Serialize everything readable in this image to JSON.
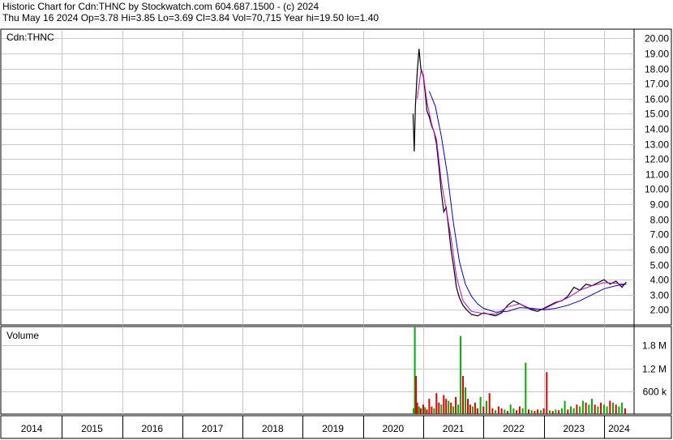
{
  "header": {
    "line1": "Historic Chart for Cdn:THNC by Stockwatch.com 604.687.1500 - (c) 2024",
    "line2": "Thu May 16 2024  Op=3.78  Hi=3.85  Lo=3.69  Cl=3.84  Vol=70,715  Year hi=19.50  lo=1.40"
  },
  "colors": {
    "price": "#000000",
    "ma_short": "#cc00cc",
    "ma_long": "#0000cc",
    "volume_up": "#00b000",
    "volume_down": "#e00000",
    "grid": "#c8c8c8"
  },
  "chart_data": [
    {
      "type": "line",
      "panel": "price",
      "label": "Cdn:THNC",
      "ylim": [
        1,
        20.5
      ],
      "y_ticks": [
        "20.00",
        "19.00",
        "18.00",
        "17.00",
        "16.00",
        "15.00",
        "14.00",
        "13.00",
        "12.00",
        "11.00",
        "10.00",
        "9.00",
        "8.00",
        "7.00",
        "6.00",
        "5.00",
        "4.00",
        "3.00",
        "2.00"
      ],
      "x_ticks": [
        "2014",
        "2015",
        "2016",
        "2017",
        "2018",
        "2019",
        "2020",
        "2021",
        "2022",
        "2023",
        "2024"
      ],
      "xlim": [
        2014,
        2024.5
      ],
      "grid": true,
      "series": [
        {
          "role": "price",
          "x": [
            2020.83,
            2020.85,
            2020.87,
            2020.9,
            2020.93,
            2020.96,
            2021.0,
            2021.03,
            2021.06,
            2021.1,
            2021.14,
            2021.18,
            2021.22,
            2021.26,
            2021.3,
            2021.34,
            2021.38,
            2021.42,
            2021.46,
            2021.5,
            2021.55,
            2021.6,
            2021.66,
            2021.72,
            2021.8,
            2021.9,
            2022.0,
            2022.1,
            2022.2,
            2022.3,
            2022.4,
            2022.5,
            2022.6,
            2022.7,
            2022.8,
            2022.9,
            2023.0,
            2023.1,
            2023.2,
            2023.3,
            2023.4,
            2023.5,
            2023.6,
            2023.7,
            2023.8,
            2023.9,
            2024.0,
            2024.1,
            2024.2,
            2024.3,
            2024.37
          ],
          "y": [
            15.0,
            12.5,
            15.5,
            17.8,
            19.3,
            18.0,
            17.5,
            16.5,
            15.2,
            14.8,
            14.2,
            13.8,
            13.0,
            11.5,
            9.8,
            8.5,
            8.8,
            7.5,
            6.0,
            5.0,
            3.5,
            2.8,
            2.3,
            2.0,
            1.7,
            1.6,
            1.8,
            1.7,
            1.6,
            1.8,
            2.3,
            2.6,
            2.4,
            2.2,
            2.0,
            1.9,
            2.1,
            2.3,
            2.5,
            2.6,
            2.9,
            3.5,
            3.3,
            3.7,
            3.6,
            3.8,
            4.0,
            3.7,
            3.9,
            3.5,
            3.84
          ]
        },
        {
          "role": "moving-average-short",
          "x": [
            2020.9,
            2020.96,
            2021.0,
            2021.06,
            2021.14,
            2021.22,
            2021.3,
            2021.38,
            2021.46,
            2021.55,
            2021.66,
            2021.8,
            2022.0,
            2022.2,
            2022.4,
            2022.6,
            2022.8,
            2023.0,
            2023.2,
            2023.4,
            2023.6,
            2023.8,
            2024.0,
            2024.2,
            2024.37
          ],
          "y": [
            16.0,
            17.8,
            17.6,
            15.8,
            14.3,
            13.3,
            10.5,
            8.7,
            6.8,
            4.2,
            2.6,
            1.9,
            1.75,
            1.7,
            2.2,
            2.4,
            2.05,
            2.05,
            2.45,
            2.8,
            3.3,
            3.6,
            3.8,
            3.75,
            3.7
          ]
        },
        {
          "role": "moving-average-long",
          "x": [
            2021.1,
            2021.2,
            2021.3,
            2021.4,
            2021.5,
            2021.6,
            2021.7,
            2021.8,
            2021.9,
            2022.0,
            2022.2,
            2022.4,
            2022.6,
            2022.8,
            2023.0,
            2023.2,
            2023.4,
            2023.6,
            2023.8,
            2024.0,
            2024.2,
            2024.37
          ],
          "y": [
            16.5,
            15.5,
            13.5,
            11.0,
            7.8,
            5.2,
            3.7,
            2.9,
            2.4,
            2.1,
            1.85,
            1.9,
            2.15,
            2.1,
            2.0,
            2.1,
            2.3,
            2.6,
            3.0,
            3.4,
            3.6,
            3.7
          ]
        }
      ]
    },
    {
      "type": "bar",
      "panel": "volume",
      "label": "Volume",
      "ylim": [
        0,
        2300000
      ],
      "y_ticks": [
        {
          "value": 1800000,
          "label": "1.8 M"
        },
        {
          "value": 1200000,
          "label": "1.2 M"
        },
        {
          "value": 600000,
          "label": "600 k"
        }
      ],
      "grid": true,
      "x": [
        2020.84,
        2020.86,
        2020.88,
        2020.9,
        2020.93,
        2020.96,
        2021.0,
        2021.03,
        2021.06,
        2021.1,
        2021.14,
        2021.18,
        2021.22,
        2021.26,
        2021.3,
        2021.34,
        2021.38,
        2021.42,
        2021.46,
        2021.5,
        2021.54,
        2021.58,
        2021.62,
        2021.66,
        2021.7,
        2021.74,
        2021.78,
        2021.82,
        2021.86,
        2021.9,
        2021.95,
        2022.0,
        2022.05,
        2022.1,
        2022.15,
        2022.2,
        2022.25,
        2022.3,
        2022.35,
        2022.4,
        2022.45,
        2022.5,
        2022.55,
        2022.6,
        2022.65,
        2022.7,
        2022.75,
        2022.8,
        2022.85,
        2022.9,
        2022.95,
        2023.0,
        2023.05,
        2023.1,
        2023.15,
        2023.2,
        2023.25,
        2023.3,
        2023.35,
        2023.4,
        2023.45,
        2023.5,
        2023.55,
        2023.6,
        2023.65,
        2023.7,
        2023.75,
        2023.8,
        2023.85,
        2023.9,
        2023.95,
        2024.0,
        2024.05,
        2024.1,
        2024.15,
        2024.2,
        2024.25,
        2024.3,
        2024.35
      ],
      "values": [
        150000,
        2300000,
        1000000,
        300000,
        200000,
        150000,
        250000,
        180000,
        120000,
        400000,
        200000,
        150000,
        550000,
        300000,
        250000,
        500000,
        400000,
        350000,
        300000,
        200000,
        450000,
        250000,
        2050000,
        1000000,
        700000,
        400000,
        250000,
        200000,
        300000,
        150000,
        450000,
        200000,
        350000,
        550000,
        150000,
        100000,
        200000,
        150000,
        120000,
        80000,
        250000,
        150000,
        100000,
        200000,
        150000,
        1350000,
        120000,
        100000,
        80000,
        120000,
        100000,
        150000,
        1100000,
        100000,
        80000,
        120000,
        100000,
        150000,
        350000,
        120000,
        200000,
        150000,
        250000,
        200000,
        350000,
        300000,
        250000,
        400000,
        250000,
        200000,
        300000,
        250000,
        200000,
        350000,
        300000,
        250000,
        200000,
        300000,
        150000
      ],
      "direction": [
        "up",
        "up",
        "down",
        "down",
        "up",
        "down",
        "down",
        "up",
        "down",
        "down",
        "down",
        "up",
        "down",
        "down",
        "up",
        "down",
        "down",
        "up",
        "down",
        "up",
        "down",
        "up",
        "up",
        "down",
        "up",
        "down",
        "down",
        "up",
        "down",
        "down",
        "up",
        "down",
        "up",
        "down",
        "down",
        "up",
        "down",
        "down",
        "up",
        "down",
        "up",
        "up",
        "down",
        "down",
        "up",
        "up",
        "down",
        "up",
        "down",
        "down",
        "up",
        "down",
        "down",
        "up",
        "down",
        "up",
        "down",
        "up",
        "up",
        "down",
        "up",
        "up",
        "down",
        "up",
        "up",
        "down",
        "up",
        "up",
        "down",
        "up",
        "down",
        "up",
        "up",
        "down",
        "up",
        "down",
        "up",
        "up",
        "down"
      ]
    }
  ]
}
